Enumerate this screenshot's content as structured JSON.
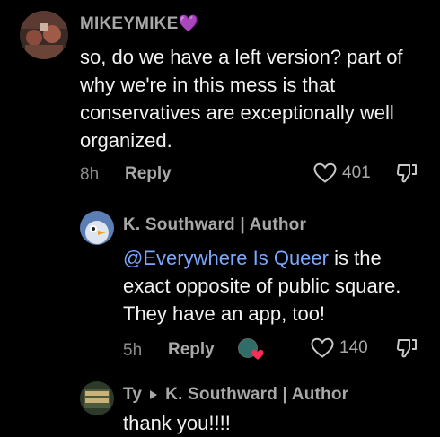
{
  "comments": [
    {
      "author": "MIKEYMIKE",
      "author_badge": "💜",
      "text": "so, do we have a left version? part of why we're in this mess is that conservatives are exceptionally well organized.",
      "time": "8h",
      "reply_label": "Reply",
      "likes": "401"
    }
  ],
  "replies": [
    {
      "author": "K. Southward | Author",
      "mention": "@Everywhere Is Queer",
      "text": " is the exact opposite of public square. They have an app, too!",
      "time": "5h",
      "reply_label": "Reply",
      "likes": "140"
    },
    {
      "author": "Ty",
      "reply_to": "K. Southward | Author",
      "text": "thank you!!!!"
    }
  ],
  "colors": {
    "background": "#000000",
    "mention": "#7aa7ff",
    "muted": "#8a8a8a",
    "heart_badge": "#ff2d55"
  },
  "icons": [
    "heart-outline-icon",
    "dislike-icon",
    "play-triangle-icon"
  ]
}
